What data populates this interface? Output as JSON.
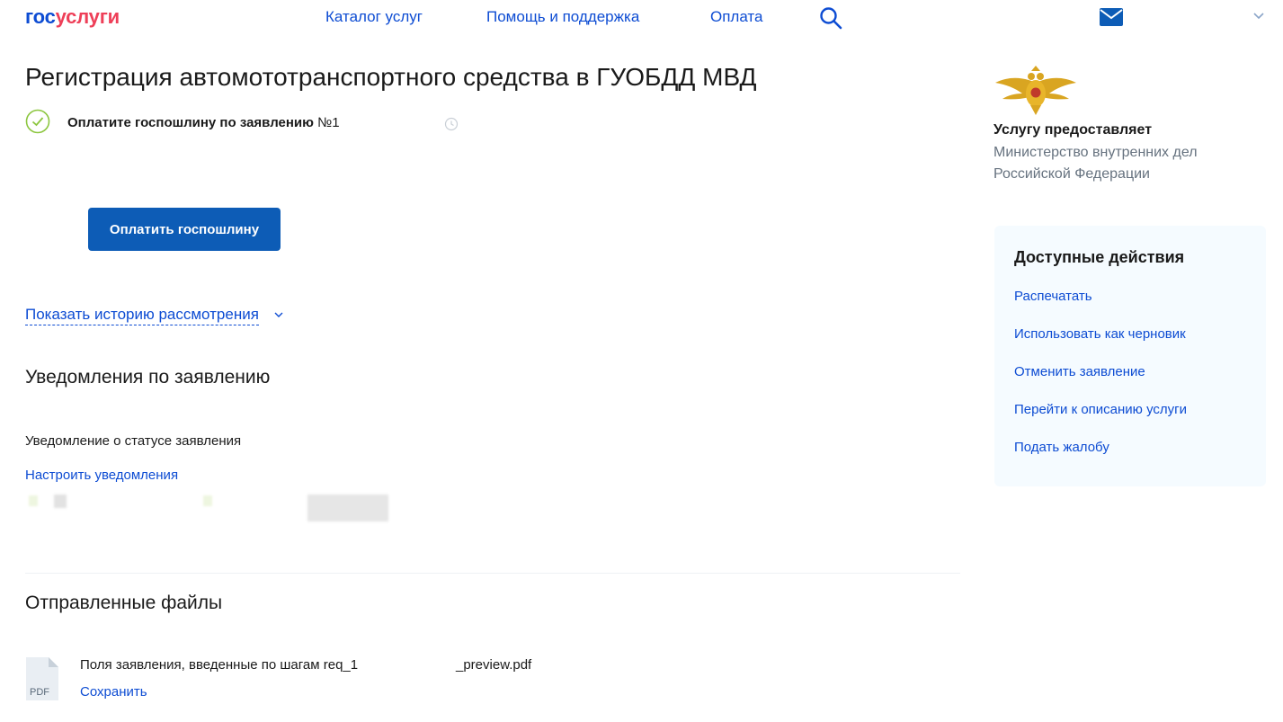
{
  "header": {
    "logo_gos": "гос",
    "logo_uslugi": "услуги",
    "nav": [
      "Каталог услуг",
      "Помощь и поддержка",
      "Оплата"
    ]
  },
  "main": {
    "title": "Регистрация автомототранспортного средства в ГУОБДД МВД",
    "status_bold": "Оплатите госпошлину по заявлению",
    "status_number": "№1",
    "pay_button": "Оплатить госпошлину",
    "history_link": "Показать историю рассмотрения",
    "notifications_title": "Уведомления по заявлению",
    "notification_status": "Уведомление о статусе заявления",
    "notification_settings_link": "Настроить уведомления",
    "files_title": "Отправленные файлы",
    "file": {
      "name": "Поля заявления, введенные по шагам req_1",
      "name_tail": "_preview.pdf",
      "type": "PDF",
      "save_link": "Сохранить"
    }
  },
  "sidebar": {
    "provider_label": "Услугу предоставляет",
    "provider_name": "Министерство внутренних дел Российской Федерации",
    "actions_title": "Доступные действия",
    "actions": [
      "Распечатать",
      "Использовать как черновик",
      "Отменить заявление",
      "Перейти к описанию услуги",
      "Подать жалобу"
    ]
  },
  "colors": {
    "brand_blue": "#0d4cd3",
    "brand_red": "#ee3f58",
    "button_blue": "#0d5cb6",
    "success_green": "#8cc63f"
  },
  "icons": [
    "search-icon",
    "mail-icon",
    "chevron-down-icon",
    "check-circle-icon",
    "clock-icon",
    "pdf-file-icon",
    "emblem-icon"
  ]
}
